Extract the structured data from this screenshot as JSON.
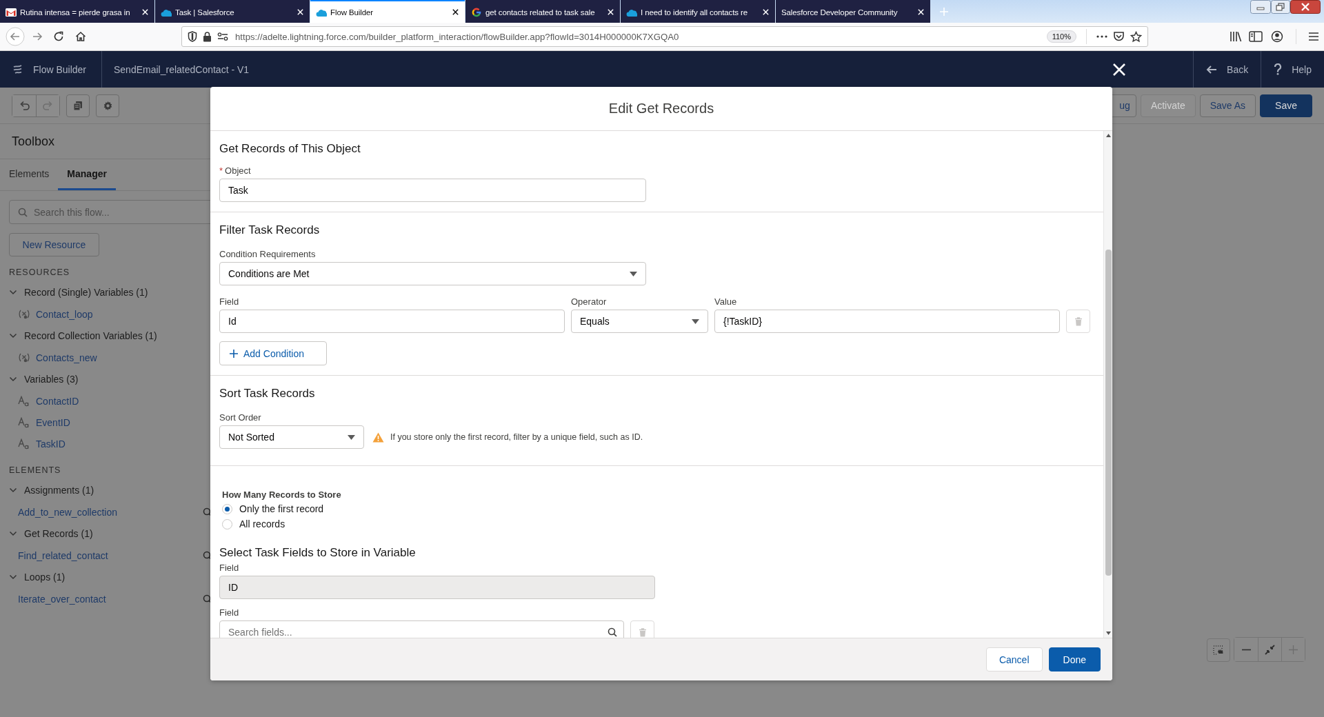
{
  "browser": {
    "tabs": [
      {
        "title": "Rutina intensa = pierde grasa in",
        "kind": "mail",
        "selected": false
      },
      {
        "title": "Task | Salesforce",
        "kind": "cloud",
        "selected": false
      },
      {
        "title": "Flow Builder",
        "kind": "cloud",
        "selected": true
      },
      {
        "title": "get contacts related to task sale",
        "kind": "google",
        "selected": false
      },
      {
        "title": "I need to identify all contacts re",
        "kind": "cloud",
        "selected": false
      },
      {
        "title": "Salesforce Developer Community",
        "kind": "plain",
        "selected": false
      }
    ],
    "url": "https://adelte.lightning.force.com/builder_platform_interaction/flowBuilder.app?flowId=3014H000000K7XGQA0",
    "zoom": "110%"
  },
  "app_header": {
    "app_name": "Flow Builder",
    "flow_name": "SendEmail_relatedContact - V1",
    "back": "Back",
    "help": "Help"
  },
  "toolbar": {
    "buttons": [
      {
        "label": "ug",
        "kind": "neutral"
      },
      {
        "label": "Activate",
        "kind": "disabled"
      },
      {
        "label": "Save As",
        "kind": "neutral"
      },
      {
        "label": "Save",
        "kind": "brand"
      }
    ]
  },
  "sidebar": {
    "title": "Toolbox",
    "tabs": [
      {
        "label": "Elements",
        "selected": false
      },
      {
        "label": "Manager",
        "selected": true
      }
    ],
    "search": {
      "placeholder": "Search this flow..."
    },
    "new_resource": "New Resource",
    "sections": [
      {
        "heading": "RESOURCES",
        "groups": [
          {
            "label": "Record (Single) Variables (1)",
            "expanded": true,
            "children": [
              {
                "label": "Contact_loop",
                "kind": "record"
              }
            ]
          },
          {
            "label": "Record Collection Variables (1)",
            "expanded": true,
            "children": [
              {
                "label": "Contacts_new",
                "kind": "record"
              }
            ]
          },
          {
            "label": "Variables (3)",
            "expanded": true,
            "children": [
              {
                "label": "ContactID",
                "kind": "text"
              },
              {
                "label": "EventID",
                "kind": "text"
              },
              {
                "label": "TaskID",
                "kind": "text"
              }
            ]
          }
        ]
      },
      {
        "heading": "ELEMENTS",
        "groups": [
          {
            "label": "Assignments (1)",
            "expanded": true,
            "children": [
              {
                "label": "Add_to_new_collection",
                "kind": "element"
              }
            ]
          },
          {
            "label": "Get Records (1)",
            "expanded": true,
            "children": [
              {
                "label": "Find_related_contact",
                "kind": "element"
              }
            ]
          },
          {
            "label": "Loops (1)",
            "expanded": true,
            "children": [
              {
                "label": "Iterate_over_contact",
                "kind": "element"
              }
            ]
          }
        ]
      }
    ]
  },
  "modal": {
    "title": "Edit Get Records",
    "object_section": {
      "heading": "Get Records of This Object",
      "required_mark": "*",
      "object_label": "Object",
      "object_value": "Task"
    },
    "filter_section": {
      "heading": "Filter Task Records",
      "requirements_label": "Condition Requirements",
      "requirements_value": "Conditions are Met",
      "conditions": [
        {
          "field_label": "Field",
          "field": "Id",
          "operator_label": "Operator",
          "operator": "Equals",
          "value_label": "Value",
          "value": "{!TaskID}"
        }
      ],
      "add_condition": "Add Condition"
    },
    "sort_section": {
      "heading": "Sort Task Records",
      "sort_label": "Sort Order",
      "sort_value": "Not Sorted",
      "warning": "If you store only the first record, filter by a unique field, such as ID."
    },
    "store_section": {
      "heading": "How Many Records to Store",
      "options": [
        {
          "label": "Only the first record",
          "selected": true
        },
        {
          "label": "All records",
          "selected": false
        }
      ]
    },
    "fields_section": {
      "heading": "Select Task Fields to Store in Variable",
      "fields": [
        {
          "label": "Field",
          "kind": "fixed",
          "value": "ID"
        },
        {
          "label": "Field",
          "kind": "search",
          "placeholder": "Search fields..."
        }
      ]
    },
    "buttons": [
      {
        "label": "Cancel",
        "kind": "neutral"
      },
      {
        "label": "Done",
        "kind": "brand"
      }
    ]
  }
}
